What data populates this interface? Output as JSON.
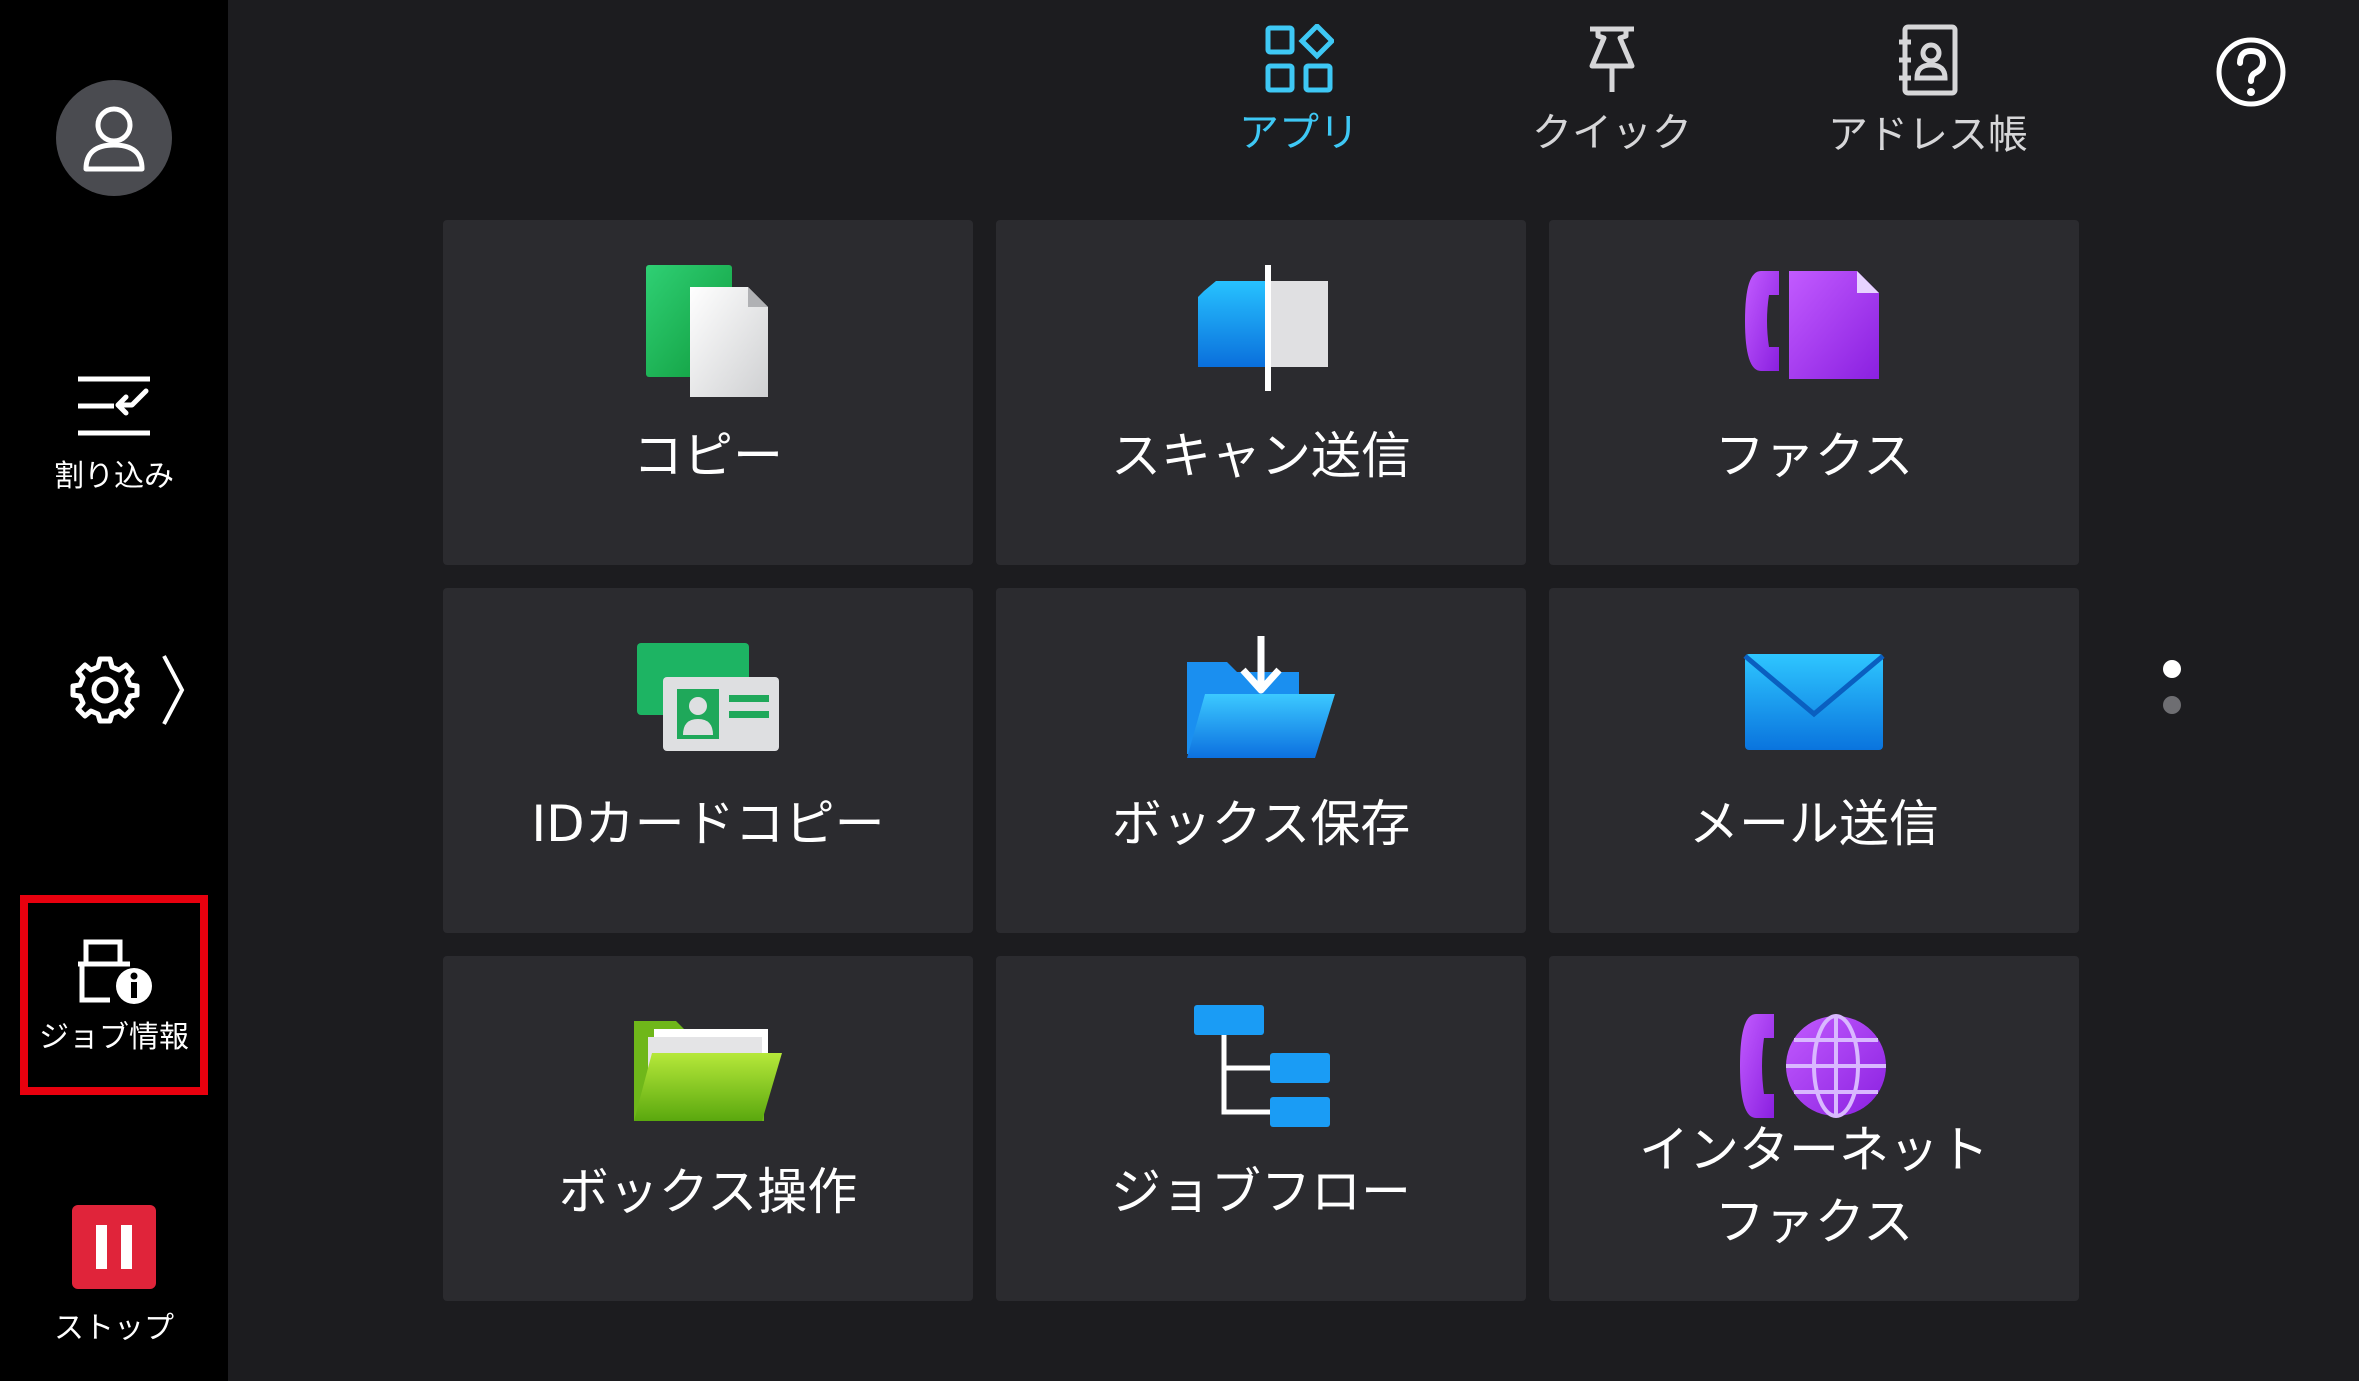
{
  "sidebar": {
    "interrupt_label": "割り込み",
    "job_info_label": "ジョブ情報",
    "stop_label": "ストップ"
  },
  "tabs": [
    {
      "label": "アプリ",
      "active": true
    },
    {
      "label": "クイック",
      "active": false
    },
    {
      "label": "アドレス帳",
      "active": false
    }
  ],
  "tiles": [
    {
      "label": "コピー"
    },
    {
      "label": "スキャン送信"
    },
    {
      "label": "ファクス"
    },
    {
      "label": "IDカードコピー"
    },
    {
      "label": "ボックス保存"
    },
    {
      "label": "メール送信"
    },
    {
      "label": "ボックス操作"
    },
    {
      "label": "ジョブフロー"
    },
    {
      "label_line1": "インターネット",
      "label_line2": "ファクス"
    }
  ],
  "pager": {
    "current_page": 1,
    "total_pages": 2
  },
  "colors": {
    "accent": "#3ec8f5",
    "highlight": "#e8000e",
    "stop": "#e0243a"
  }
}
